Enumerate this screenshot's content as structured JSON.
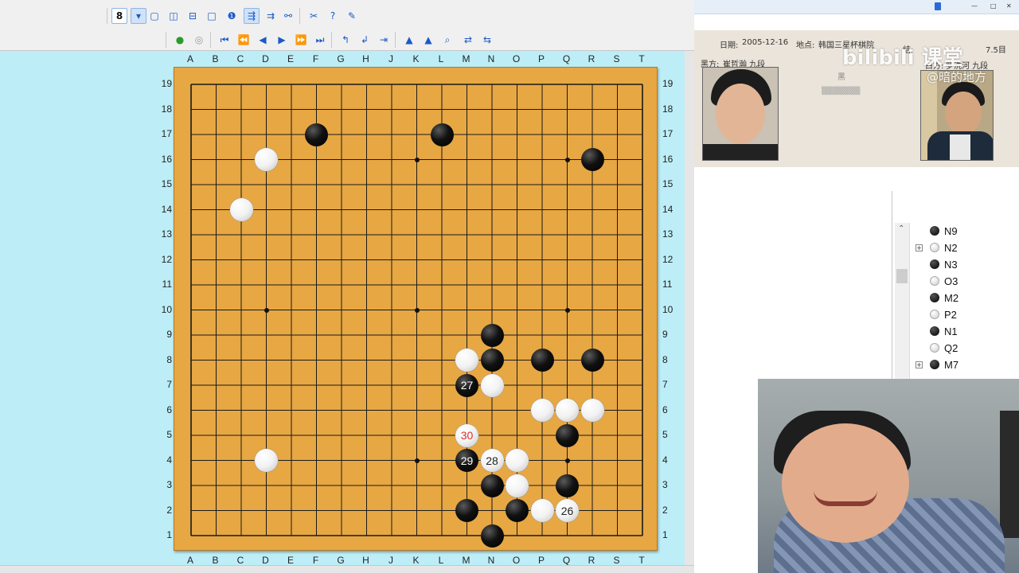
{
  "toolbar": {
    "row1": [
      {
        "name": "move-number-button",
        "glyph": "8",
        "sel": true
      },
      {
        "name": "dropdown-arrow-button",
        "glyph": "▾",
        "sel": true
      },
      {
        "name": "window-1-button",
        "glyph": "▢"
      },
      {
        "name": "split-vertical-button",
        "glyph": "◫"
      },
      {
        "name": "split-horizontal-button",
        "glyph": "⊟"
      },
      {
        "name": "blank-panel-button",
        "glyph": "□"
      },
      {
        "name": "show-numbers-button",
        "glyph": "❶"
      },
      {
        "name": "tree-view-button",
        "glyph": "⇶",
        "sel": true
      },
      {
        "name": "branch-view-button",
        "glyph": "⇉"
      },
      {
        "name": "hierarchy-button",
        "glyph": "⚯"
      },
      {
        "name": "tools-button",
        "glyph": "✂"
      },
      {
        "name": "hint-button",
        "glyph": "?"
      },
      {
        "name": "brush-button",
        "glyph": "✎"
      }
    ],
    "row2": [
      {
        "name": "play-green-button",
        "glyph": "●"
      },
      {
        "name": "stop-button",
        "glyph": "◎"
      },
      {
        "name": "first-move-button",
        "glyph": "⏮"
      },
      {
        "name": "back-many-button",
        "glyph": "⏪"
      },
      {
        "name": "back-one-button",
        "glyph": "◀"
      },
      {
        "name": "forward-one-button",
        "glyph": "▶"
      },
      {
        "name": "forward-many-button",
        "glyph": "⏩"
      },
      {
        "name": "last-move-button",
        "glyph": "⏭"
      },
      {
        "name": "variation-up-button",
        "glyph": "↰"
      },
      {
        "name": "variation-side-button",
        "glyph": "↲"
      },
      {
        "name": "variation-next-button",
        "glyph": "⇥"
      },
      {
        "name": "mark-1-button",
        "glyph": "▲"
      },
      {
        "name": "mark-2-button",
        "glyph": "▲"
      },
      {
        "name": "search-button",
        "glyph": "⌕"
      },
      {
        "name": "flip-left-button",
        "glyph": "⇄"
      },
      {
        "name": "flip-right-button",
        "glyph": "⇆"
      }
    ]
  },
  "board": {
    "columns": [
      "A",
      "B",
      "C",
      "D",
      "E",
      "F",
      "G",
      "H",
      "J",
      "K",
      "L",
      "M",
      "N",
      "O",
      "P",
      "Q",
      "R",
      "S",
      "T"
    ],
    "rows": [
      "19",
      "18",
      "17",
      "16",
      "15",
      "14",
      "13",
      "12",
      "11",
      "10",
      "9",
      "8",
      "7",
      "6",
      "5",
      "4",
      "3",
      "2",
      "1"
    ],
    "hoshi": [
      "D16",
      "K16",
      "Q16",
      "D10",
      "K10",
      "Q10",
      "D4",
      "K4",
      "Q4"
    ],
    "stones": [
      {
        "pos": "F17",
        "color": "black",
        "label": ""
      },
      {
        "pos": "L17",
        "color": "black",
        "label": ""
      },
      {
        "pos": "R16",
        "color": "black",
        "label": ""
      },
      {
        "pos": "D16",
        "color": "white",
        "label": ""
      },
      {
        "pos": "C14",
        "color": "white",
        "label": ""
      },
      {
        "pos": "D4",
        "color": "white",
        "label": ""
      },
      {
        "pos": "N9",
        "color": "black",
        "label": ""
      },
      {
        "pos": "M8",
        "color": "white",
        "label": ""
      },
      {
        "pos": "N8",
        "color": "black",
        "label": ""
      },
      {
        "pos": "P8",
        "color": "black",
        "label": ""
      },
      {
        "pos": "R8",
        "color": "black",
        "label": ""
      },
      {
        "pos": "M7",
        "color": "black",
        "label": "27"
      },
      {
        "pos": "N7",
        "color": "white",
        "label": ""
      },
      {
        "pos": "P6",
        "color": "white",
        "label": ""
      },
      {
        "pos": "Q6",
        "color": "white",
        "label": ""
      },
      {
        "pos": "R6",
        "color": "white",
        "label": ""
      },
      {
        "pos": "M5",
        "color": "white",
        "label": "30",
        "red": true
      },
      {
        "pos": "Q5",
        "color": "black",
        "label": ""
      },
      {
        "pos": "M4",
        "color": "black",
        "label": "29"
      },
      {
        "pos": "N4",
        "color": "white",
        "label": "28"
      },
      {
        "pos": "O4",
        "color": "white",
        "label": ""
      },
      {
        "pos": "N3",
        "color": "black",
        "label": ""
      },
      {
        "pos": "O3",
        "color": "white",
        "label": ""
      },
      {
        "pos": "Q3",
        "color": "black",
        "label": ""
      },
      {
        "pos": "M2",
        "color": "black",
        "label": ""
      },
      {
        "pos": "O2",
        "color": "black",
        "label": ""
      },
      {
        "pos": "P2",
        "color": "white",
        "label": ""
      },
      {
        "pos": "Q2",
        "color": "white",
        "label": "26"
      },
      {
        "pos": "N1",
        "color": "black",
        "label": ""
      }
    ]
  },
  "game_info": {
    "date_label": "日期:",
    "date": "2005-12-16",
    "place_label": "地点:",
    "place": "韩国三星杯棋院",
    "black_label": "黑方:",
    "black_player": "崔哲瀚 九段",
    "white_label": "白方:",
    "white_player": "罗洗河 九段",
    "komi": "7.5目",
    "result_label": "结:",
    "extra": "黑"
  },
  "watermark": {
    "brand": "bilibili 课堂",
    "handle": "@暗的地方"
  },
  "move_tree": [
    {
      "color": "black",
      "label": "N9",
      "plus": false
    },
    {
      "color": "white",
      "label": "N2",
      "plus": true
    },
    {
      "color": "black",
      "label": "N3",
      "plus": false
    },
    {
      "color": "white",
      "label": "O3",
      "plus": false
    },
    {
      "color": "black",
      "label": "M2",
      "plus": false
    },
    {
      "color": "white",
      "label": "P2",
      "plus": false
    },
    {
      "color": "black",
      "label": "N1",
      "plus": false
    },
    {
      "color": "white",
      "label": "Q2",
      "plus": false
    },
    {
      "color": "black",
      "label": "M7",
      "plus": true
    }
  ]
}
